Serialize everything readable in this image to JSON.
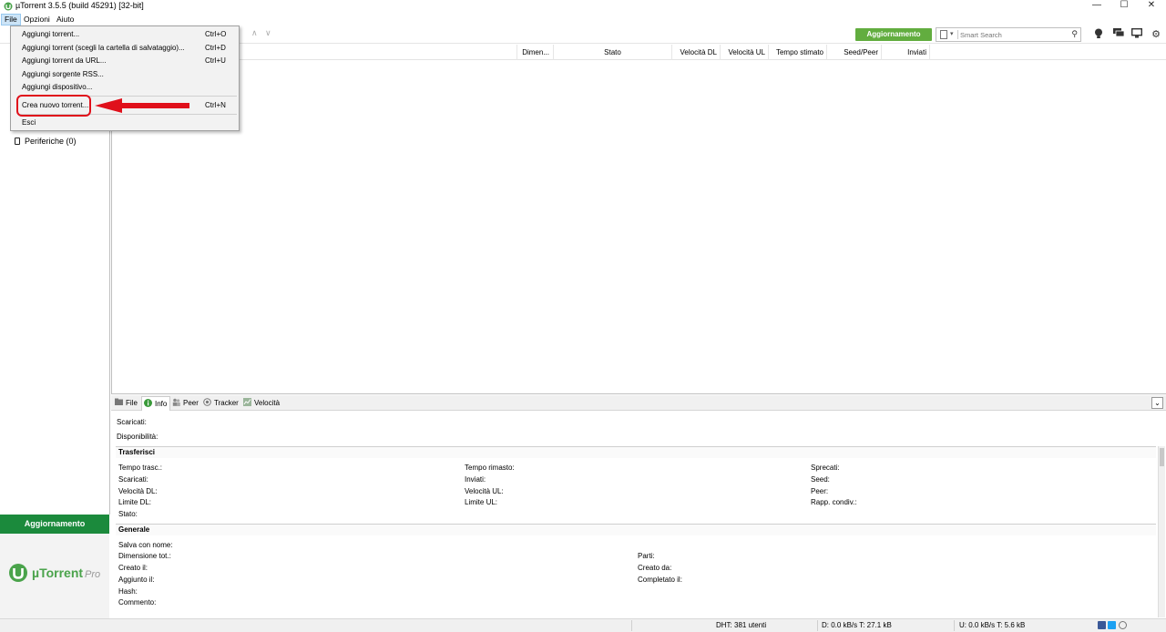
{
  "window": {
    "title": "µTorrent 3.5.5  (build 45291) [32-bit]",
    "controls": [
      "—",
      "☐",
      "✕"
    ]
  },
  "menubar": {
    "items": [
      "File",
      "Opzioni",
      "Aiuto"
    ]
  },
  "file_menu": {
    "items": [
      {
        "label": "Aggiungi torrent...",
        "shortcut": "Ctrl+O"
      },
      {
        "label": "Aggiungi torrent (scegli la cartella di salvataggio)...",
        "shortcut": "Ctrl+D"
      },
      {
        "label": "Aggiungi torrent da URL...",
        "shortcut": "Ctrl+U"
      },
      {
        "label": "Aggiungi sorgente RSS...",
        "shortcut": ""
      },
      {
        "label": "Aggiungi dispositivo...",
        "shortcut": ""
      },
      {
        "label": "Crea nuovo torrent...",
        "shortcut": "Ctrl+N"
      },
      {
        "label": "Esci",
        "shortcut": ""
      }
    ]
  },
  "toolbar": {
    "update_label": "Aggiornamento",
    "search_placeholder": "Smart Search"
  },
  "sidebar": {
    "periferiche": "Periferiche (0)",
    "update_label": "Aggiornamento",
    "logo_name": "µTorrent",
    "logo_suffix": "Pro"
  },
  "list_columns": [
    "Dimen...",
    "Stato",
    "Velocità DL",
    "Velocità UL",
    "Tempo stimato",
    "Seed/Peer",
    "Inviati"
  ],
  "detail_tabs": [
    "File",
    "Info",
    "Peer",
    "Tracker",
    "Velocità"
  ],
  "info": {
    "scaricati": "Scaricati:",
    "disponibilita": "Disponibilità:",
    "trasferisci_title": "Trasferisci",
    "trasferisci": {
      "col1": [
        "Tempo trasc.:",
        "Scaricati:",
        "Velocità DL:",
        "Limite DL:",
        "Stato:"
      ],
      "col2": [
        "Tempo rimasto:",
        "Inviati:",
        "Velocità UL:",
        "Limite UL:"
      ],
      "col3": [
        "Sprecati:",
        "Seed:",
        "Peer:",
        "Rapp. condiv.:"
      ]
    },
    "generale_title": "Generale",
    "generale": {
      "col1": [
        "Salva con nome:",
        "Dimensione tot.:",
        "Creato il:",
        "Aggiunto il:",
        "Hash:",
        "Commento:"
      ],
      "col2": [
        "Parti:",
        "Creato da:",
        "Completato il:"
      ]
    }
  },
  "statusbar": {
    "dht": "DHT: 381 utenti",
    "download": "D: 0.0 kB/s T: 27.1 kB",
    "upload": "U: 0.0 kB/s T: 5.6 kB"
  },
  "colors": {
    "accent_green": "#62ad3f",
    "sidebar_green": "#1b8a3c",
    "annotation_red": "#e0101b"
  }
}
